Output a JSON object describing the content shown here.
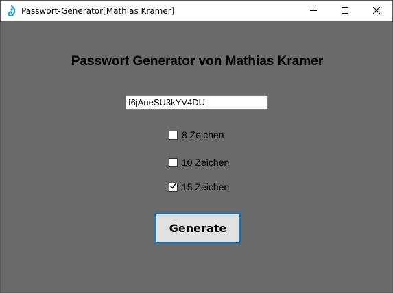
{
  "window": {
    "title": "Passwort-Generator[Mathias Kramer]",
    "app_icon": "app-icon",
    "caption_buttons": [
      "minimize-icon",
      "maximize-icon",
      "close-icon"
    ]
  },
  "main": {
    "heading": "Passwort Generator von Mathias Kramer",
    "password_value": "f6jAneSU3kYV4DU",
    "options": [
      {
        "label": "8 Zeichen",
        "checked": false
      },
      {
        "label": "10 Zeichen",
        "checked": false
      },
      {
        "label": "15 Zeichen",
        "checked": true
      }
    ],
    "generate_label": "Generate"
  },
  "colors": {
    "background": "#6a6a6a",
    "titlebar": "#ffffff",
    "button_face": "#e1e1e1",
    "button_focus_border": "#0078d7",
    "app_icon_accent": "#1ba1e2"
  }
}
